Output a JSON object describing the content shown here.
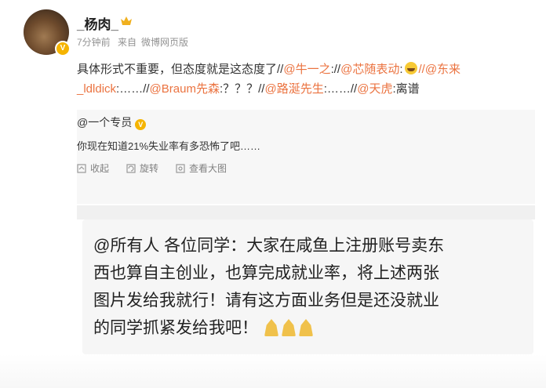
{
  "post": {
    "username": "_杨肉_",
    "meta": {
      "time": "7分钟前",
      "source_prefix": "来自",
      "source": "微博网页版"
    },
    "content": {
      "prefix": "具体形式不重要，但态度就是这态度了//",
      "mentions": [
        {
          "name": "@牛一之",
          "text": "://"
        },
        {
          "name": "@芯随表动",
          "text": ":",
          "emoji": "laugh"
        },
        {
          "name": "//@东来_ldldick",
          "text": ":……//"
        },
        {
          "name": "@Braum先森",
          "text": ":？？？//"
        },
        {
          "name": "@路涎先生",
          "text": ":……//"
        },
        {
          "name": "@天虎",
          "text": ":离谱"
        }
      ]
    }
  },
  "quote": {
    "user": "@一个专员",
    "text": "你现在知道21%失业率有多恐怖了吧……",
    "actions": [
      {
        "label": "收起",
        "icon": "collapse-icon"
      },
      {
        "label": "旋转",
        "icon": "rotate-icon"
      },
      {
        "label": "查看大图",
        "icon": "zoom-icon"
      }
    ]
  },
  "card": {
    "lines": [
      "@所有人 各位同学：大家在咸鱼上注册账号卖东",
      "西也算自主创业，也算完成就业率，将上述两张",
      "图片发给我就行！请有这方面业务但是还没就业",
      "的同学抓紧发给我吧！"
    ],
    "emoji_count": 3
  },
  "colors": {
    "mention": "#eb7340",
    "meta": "#939393",
    "badge": "#f5b400"
  }
}
